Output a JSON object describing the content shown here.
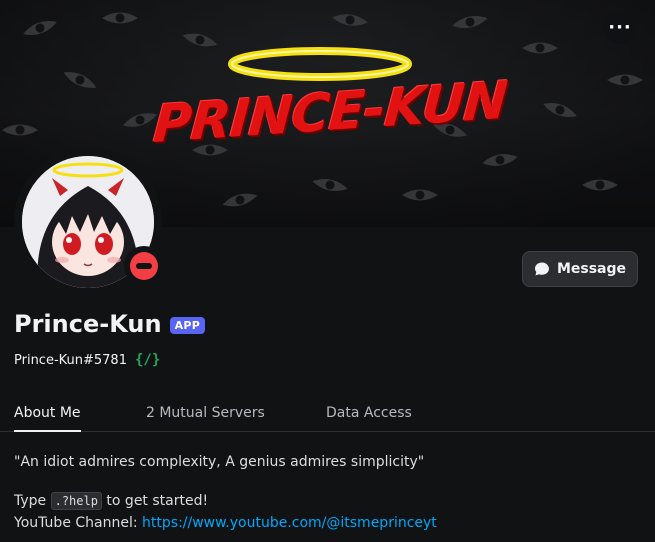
{
  "banner": {
    "title": "PRINCE-KUN",
    "more_label": "···"
  },
  "profile": {
    "display_name": "Prince-Kun",
    "badge": "APP",
    "username": "Prince-Kun#5781",
    "command_icon": "{/}",
    "status": "do-not-disturb"
  },
  "actions": {
    "message_label": "Message"
  },
  "tabs": [
    {
      "label": "About Me",
      "active": true
    },
    {
      "label": "2 Mutual Servers",
      "active": false
    },
    {
      "label": "Data Access",
      "active": false
    }
  ],
  "about": {
    "quote": "\"An idiot admires complexity, A genius admires simplicity\"",
    "type_prefix": "Type",
    "command": ".?help",
    "type_suffix": "to get started!",
    "youtube_label": "YouTube Channel:",
    "youtube_url": "https://www.youtube.com/@itsmeprinceyt"
  },
  "colors": {
    "accent": "#5865f2",
    "dnd": "#f23f43",
    "link": "#00a8fc",
    "banner_title": "#e31212",
    "halo": "#f5e015"
  }
}
